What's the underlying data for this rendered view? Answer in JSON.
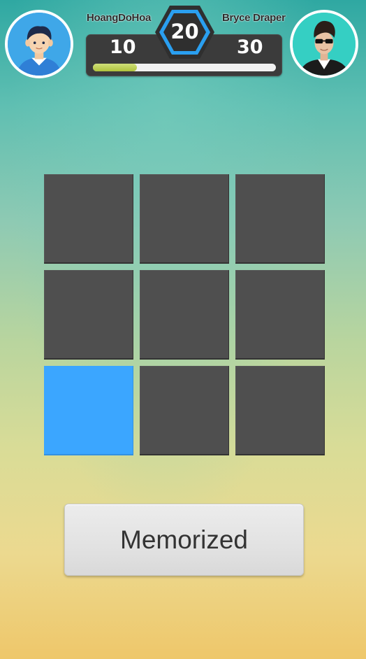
{
  "players": {
    "left": {
      "name": "HoangDoHoa",
      "score": "10",
      "avatar_icon": "boy-avatar-icon"
    },
    "right": {
      "name": "Bryce Draper",
      "score": "30",
      "avatar_icon": "man-sunglasses-photo"
    }
  },
  "timer": {
    "value": "20",
    "color": "#2a9ff0"
  },
  "progress": {
    "fraction": 0.24,
    "color": "#aec23c"
  },
  "board": {
    "rows": 3,
    "cols": 3,
    "tiles": [
      "dark",
      "dark",
      "dark",
      "dark",
      "dark",
      "dark",
      "blue",
      "dark",
      "dark"
    ],
    "colors": {
      "dark": "#4f4f4f",
      "blue": "#3ba6ff"
    }
  },
  "actions": {
    "memorized_label": "Memorized"
  }
}
